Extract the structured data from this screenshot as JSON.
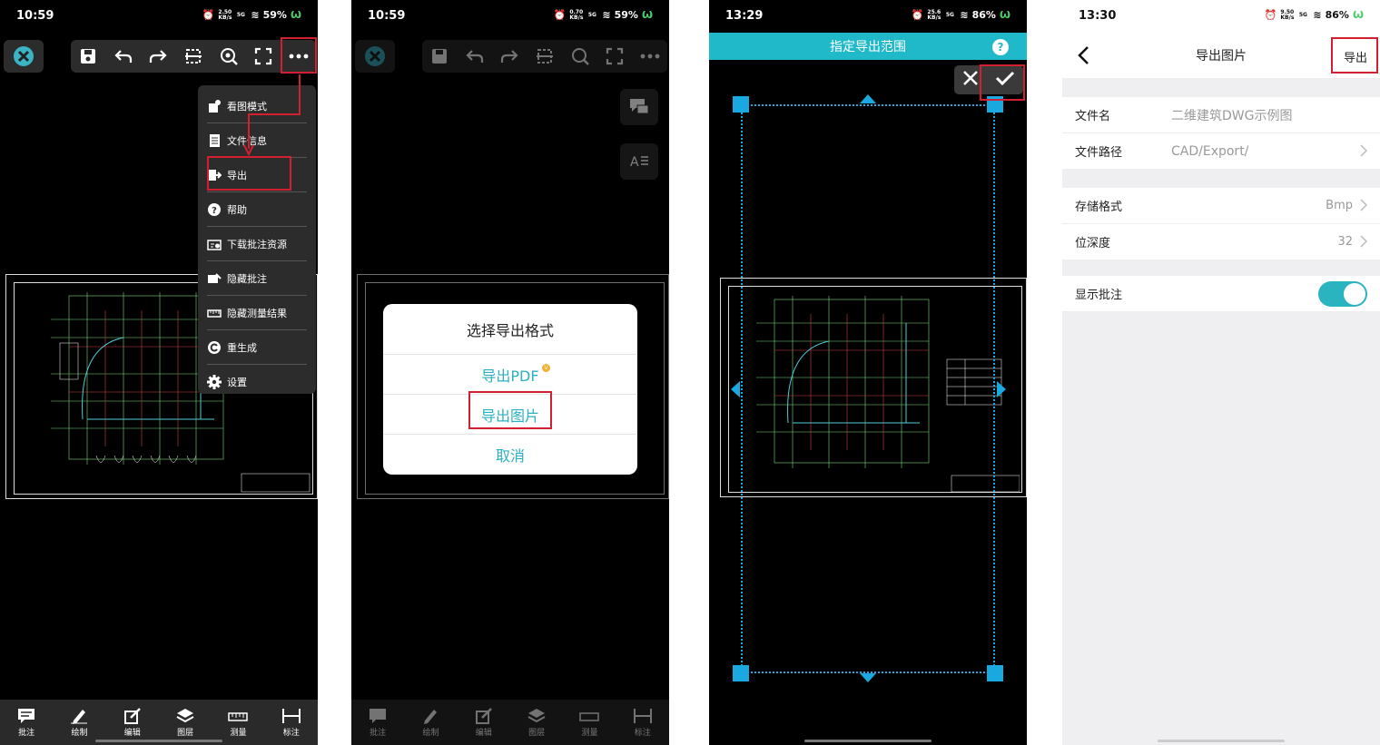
{
  "panel1": {
    "time": "10:59",
    "speed": "2.50 KB/s",
    "net": "5G",
    "battery": "59%",
    "menu": [
      {
        "label": "看图模式",
        "icon": "view-mode-icon"
      },
      {
        "label": "文件信息",
        "icon": "file-info-icon"
      },
      {
        "label": "导出",
        "icon": "export-icon"
      },
      {
        "label": "帮助",
        "icon": "help-icon"
      },
      {
        "label": "下载批注资源",
        "icon": "download-icon"
      },
      {
        "label": "隐藏批注",
        "icon": "hide-annotation-icon"
      },
      {
        "label": "隐藏测量结果",
        "icon": "hide-measure-icon"
      },
      {
        "label": "重生成",
        "icon": "regenerate-icon"
      },
      {
        "label": "设置",
        "icon": "settings-icon"
      }
    ]
  },
  "bottom": [
    {
      "label": "批注",
      "icon": "comment-icon"
    },
    {
      "label": "绘制",
      "icon": "pencil-icon"
    },
    {
      "label": "编辑",
      "icon": "edit-icon"
    },
    {
      "label": "图层",
      "icon": "layers-icon"
    },
    {
      "label": "测量",
      "icon": "ruler-icon"
    },
    {
      "label": "标注",
      "icon": "dimension-icon"
    }
  ],
  "panel2": {
    "time": "10:59",
    "speed": "0.70 KB/s",
    "net": "5G",
    "battery": "59%",
    "dialog": {
      "title": "选择导出格式",
      "export_pdf": "导出PDF",
      "export_image": "导出图片",
      "cancel": "取消"
    }
  },
  "panel3": {
    "time": "13:29",
    "speed": "25.6 KB/s",
    "net": "5G",
    "battery": "86%",
    "title": "指定导出范围",
    "help": "?"
  },
  "panel4": {
    "time": "13:30",
    "speed": "9.50 KB/s",
    "net": "5G",
    "battery": "86%",
    "nav_title": "导出图片",
    "export_btn": "导出",
    "rows": {
      "filename_label": "文件名",
      "filename_value": "二维建筑DWG示例图",
      "path_label": "文件路径",
      "path_value": "CAD/Export/",
      "format_label": "存储格式",
      "format_value": "Bmp",
      "depth_label": "位深度",
      "depth_value": "32",
      "annot_label": "显示批注"
    }
  },
  "colors": {
    "accent": "#20b9c9",
    "highlight": "#d32030",
    "selection": "#1aa8e0"
  }
}
